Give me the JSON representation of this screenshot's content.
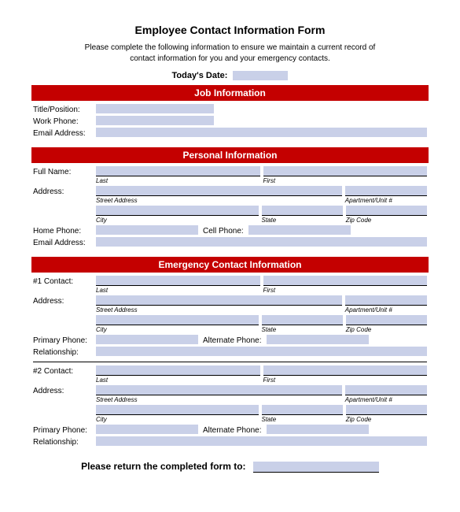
{
  "title": "Employee Contact Information Form",
  "intro": "Please complete the following information to ensure we maintain a current record of contact information for you and your emergency contacts.",
  "date_label": "Today's Date:",
  "sections": {
    "job": {
      "header": "Job Information",
      "fields": {
        "title_position": "Title/Position:",
        "work_phone": "Work Phone:",
        "email": "Email Address:"
      }
    },
    "personal": {
      "header": "Personal Information",
      "fields": {
        "full_name": "Full Name:",
        "address": "Address:",
        "home_phone": "Home Phone:",
        "cell_phone": "Cell Phone:",
        "email": "Email Address:"
      },
      "hints": {
        "last": "Last",
        "first": "First",
        "street": "Street Address",
        "apt": "Apartment/Unit #",
        "city": "City",
        "state": "State",
        "zip": "Zip Code"
      }
    },
    "emergency": {
      "header": "Emergency Contact Information",
      "contact1": "#1 Contact:",
      "contact2": "#2 Contact:",
      "address": "Address:",
      "primary_phone": "Primary Phone:",
      "alternate_phone": "Alternate Phone:",
      "relationship": "Relationship:",
      "hints": {
        "last": "Last",
        "first": "First",
        "street": "Street Address",
        "apt": "Apartment/Unit #",
        "city": "City",
        "state": "State",
        "zip": "Zip Code"
      }
    }
  },
  "return_label": "Please return the completed form to:"
}
